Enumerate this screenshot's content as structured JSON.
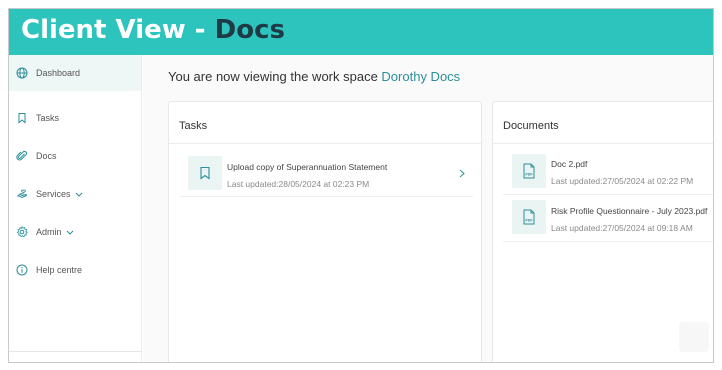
{
  "banner": {
    "title_light": "Client View - ",
    "title_dark": "Docs",
    "color": "#2ec4be"
  },
  "sidebar": {
    "items": [
      {
        "label": "Dashboard",
        "icon": "globe-icon",
        "active": true
      },
      {
        "label": "Tasks",
        "icon": "bookmark-icon"
      },
      {
        "label": "Docs",
        "icon": "paperclip-icon"
      },
      {
        "label": "Services",
        "icon": "hand-icon",
        "dropdown": true
      },
      {
        "label": "Admin",
        "icon": "gear-icon",
        "dropdown": true
      },
      {
        "label": "Help centre",
        "icon": "info-icon"
      }
    ]
  },
  "main": {
    "headline_prefix": "You are now viewing the work space ",
    "workspace_name": "Dorothy Docs",
    "accent": "#2a8f9a"
  },
  "tasks": {
    "title": "Tasks",
    "items": [
      {
        "title": "Upload copy of Superannuation Statement",
        "updated": "Last updated:28/05/2024 at 02:23 PM"
      }
    ]
  },
  "documents": {
    "title": "Documents",
    "items": [
      {
        "title": "Doc 2.pdf",
        "updated": "Last updated:27/05/2024 at 02:22 PM",
        "icon_label": "PDF"
      },
      {
        "title": "Risk Profile Questionnaire - July 2023.pdf",
        "updated": "Last updated:27/05/2024 at 09:18 AM",
        "icon_label": "PDF"
      }
    ]
  }
}
